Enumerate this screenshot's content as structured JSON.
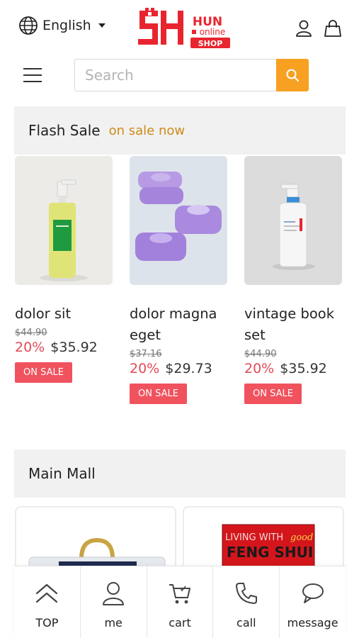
{
  "header": {
    "language": "English",
    "logo_top": "HUN",
    "logo_mid": "online",
    "logo_bottom": "SHOP"
  },
  "search": {
    "placeholder": "Search"
  },
  "flash_sale": {
    "title": "Flash Sale",
    "subtitle": "on sale now",
    "badge_label": "ON SALE",
    "products": [
      {
        "name": "dolor sit",
        "old_price": "$44.90",
        "discount": "20%",
        "price": "$35.92"
      },
      {
        "name": "dolor magna eget",
        "old_price": "$37.16",
        "discount": "20%",
        "price": "$29.73"
      },
      {
        "name": "vintage book set",
        "old_price": "$44.90",
        "discount": "20%",
        "price": "$35.92"
      }
    ]
  },
  "main_mall": {
    "title": "Main Mall",
    "cards": [
      {
        "caption": ""
      },
      {
        "caption_1": "LIVING WITH",
        "caption_2": "good",
        "caption_3": "FENG SHUI"
      }
    ]
  },
  "bottom_nav": [
    {
      "label": "TOP",
      "icon": "chevron-up-icon"
    },
    {
      "label": "me",
      "icon": "user-icon"
    },
    {
      "label": "cart",
      "icon": "cart-icon"
    },
    {
      "label": "call",
      "icon": "phone-icon"
    },
    {
      "label": "message",
      "icon": "chat-icon"
    }
  ],
  "colors": {
    "accent": "#f7a021",
    "sale_red": "#f0525e",
    "discount_red": "#e34a55",
    "brand_red": "#e8252f",
    "subtitle_gold": "#d08a18"
  }
}
